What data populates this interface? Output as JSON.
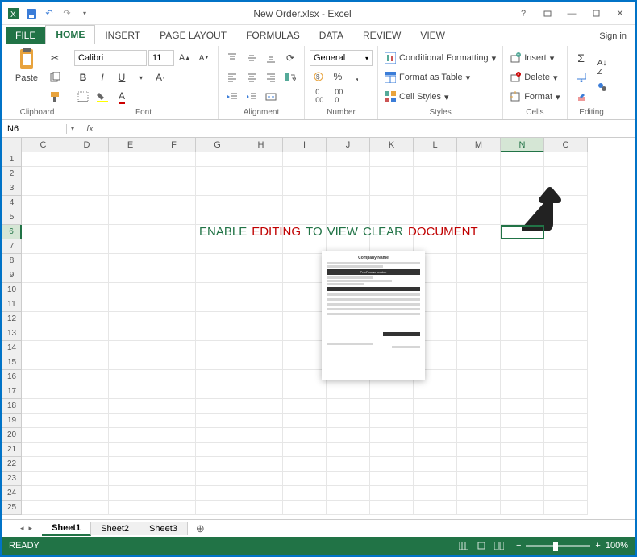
{
  "title": "New Order.xlsx - Excel",
  "signin": "Sign in",
  "tabs": [
    "FILE",
    "HOME",
    "INSERT",
    "PAGE LAYOUT",
    "FORMULAS",
    "DATA",
    "REVIEW",
    "VIEW"
  ],
  "activeTab": "HOME",
  "ribbon": {
    "clipboard": {
      "label": "Clipboard",
      "paste": "Paste"
    },
    "font": {
      "label": "Font",
      "family": "Calibri",
      "size": "11"
    },
    "alignment": {
      "label": "Alignment"
    },
    "number": {
      "label": "Number",
      "format": "General"
    },
    "styles": {
      "label": "Styles",
      "cond": "Conditional Formatting",
      "table": "Format as Table",
      "cell": "Cell Styles"
    },
    "cells": {
      "label": "Cells",
      "insert": "Insert",
      "delete": "Delete",
      "format": "Format"
    },
    "editing": {
      "label": "Editing"
    }
  },
  "namebox": "N6",
  "formula": "",
  "columns": [
    "C",
    "D",
    "E",
    "F",
    "G",
    "H",
    "I",
    "J",
    "K",
    "L",
    "M",
    "N",
    "C"
  ],
  "selectedCol": "N",
  "rows": [
    "1",
    "2",
    "3",
    "4",
    "5",
    "6",
    "7",
    "8",
    "9",
    "10",
    "11",
    "12",
    "13",
    "14",
    "15",
    "16",
    "17",
    "18",
    "19",
    "20",
    "21",
    "22",
    "23",
    "24",
    "25"
  ],
  "selectedRow": "6",
  "message": {
    "w": [
      "ENABLE",
      "EDITING",
      " TO",
      "VIEW",
      "CLEAR",
      "DOCUMENT"
    ],
    "classes": [
      "w1",
      "w2",
      "w1",
      "w1",
      "w1",
      "w2"
    ]
  },
  "invoice": {
    "title": "Company Name",
    "sub": "Pro-Forma Invoice"
  },
  "sheetTabs": [
    "Sheet1",
    "Sheet2",
    "Sheet3"
  ],
  "activeSheet": "Sheet1",
  "status": "READY",
  "zoom": "100%"
}
